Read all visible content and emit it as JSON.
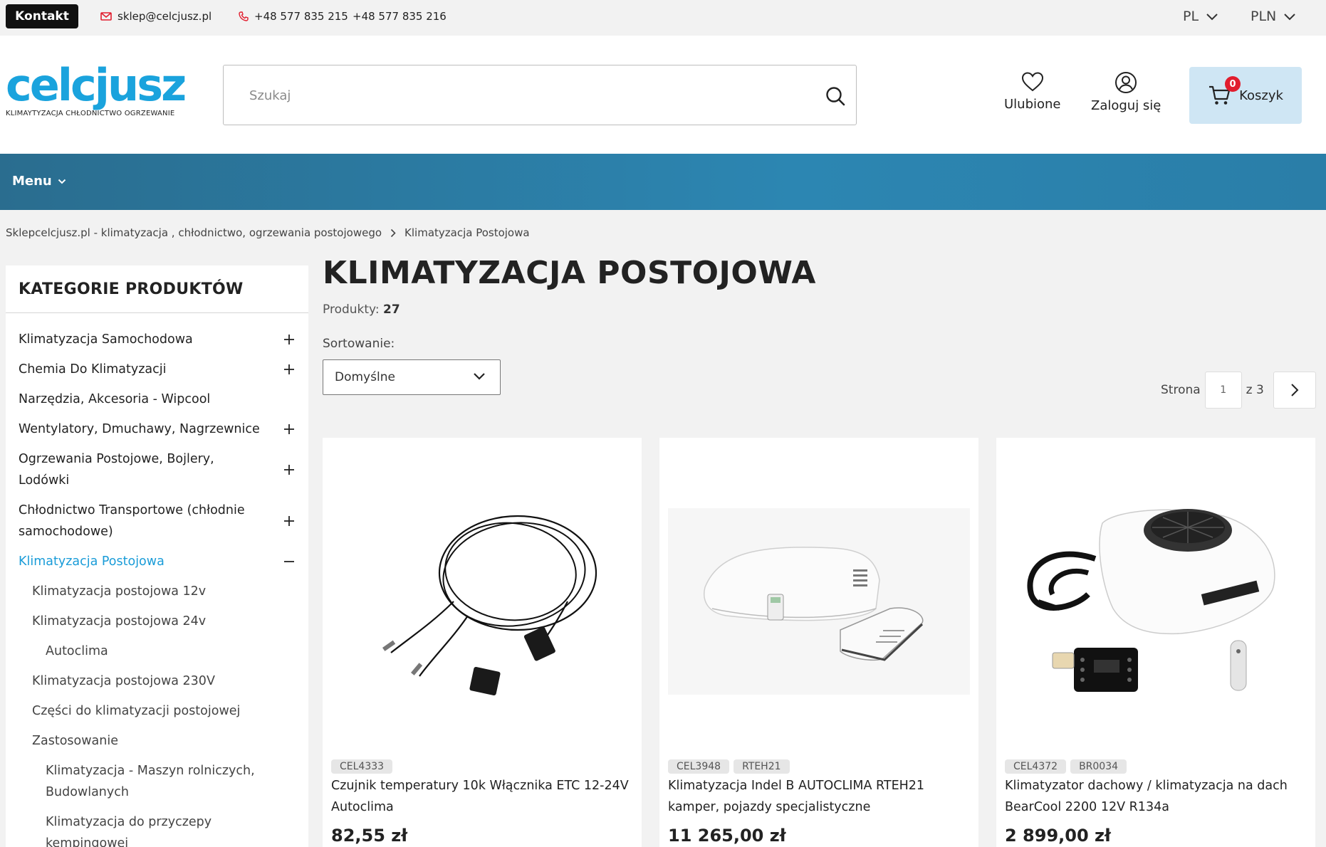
{
  "topbar": {
    "contact_label": "Kontakt",
    "email": "sklep@celcjusz.pl",
    "phone1": "+48 577 835 215",
    "phone2": "+48 577 835 216",
    "language": "PL",
    "currency": "PLN"
  },
  "header": {
    "logo_text": "celcjusz",
    "logo_tagline": "KLIMAYTYZACJA CHŁODNICTWO OGRZEWANIE",
    "search_placeholder": "Szukaj",
    "favorites_label": "Ulubione",
    "login_label": "Zaloguj się",
    "cart_label": "Koszyk",
    "cart_count": "0",
    "brand_color": "#1aa3dd"
  },
  "nav": {
    "menu_label": "Menu"
  },
  "breadcrumb": {
    "home": "Sklepcelcjusz.pl - klimatyzacja , chłodnictwo, ogrzewania postojowego",
    "current": "Klimatyzacja Postojowa"
  },
  "sidebar": {
    "title": "KATEGORIE PRODUKTÓW",
    "items": [
      {
        "label": "Klimatyzacja Samochodowa",
        "toggle": "plus",
        "level": 0
      },
      {
        "label": "Chemia Do Klimatyzacji",
        "toggle": "plus",
        "level": 0
      },
      {
        "label": "Narzędzia, Akcesoria - Wipcool",
        "toggle": "none",
        "level": 0
      },
      {
        "label": "Wentylatory, Dmuchawy, Nagrzewnice",
        "toggle": "plus",
        "level": 0
      },
      {
        "label": "Ogrzewania Postojowe, Bojlery, Lodówki",
        "toggle": "plus",
        "level": 0
      },
      {
        "label": "Chłodnictwo Transportowe (chłodnie samochodowe)",
        "toggle": "plus",
        "level": 0
      },
      {
        "label": "Klimatyzacja Postojowa",
        "toggle": "minus",
        "level": 0,
        "active": true
      },
      {
        "label": "Klimatyzacja postojowa 12v",
        "toggle": "none",
        "level": 1
      },
      {
        "label": "Klimatyzacja postojowa 24v",
        "toggle": "none",
        "level": 1
      },
      {
        "label": "Autoclima",
        "toggle": "none",
        "level": 2
      },
      {
        "label": "Klimatyzacja postojowa 230V",
        "toggle": "none",
        "level": 1
      },
      {
        "label": "Części do klimatyzacji postojowej",
        "toggle": "none",
        "level": 1
      },
      {
        "label": "Zastosowanie",
        "toggle": "none",
        "level": 1
      },
      {
        "label": "Klimatyzacja - Maszyn rolniczych, Budowlanych",
        "toggle": "none",
        "level": 2
      },
      {
        "label": "Klimatyzacja do przyczepy kempingowej",
        "toggle": "none",
        "level": 2
      }
    ]
  },
  "main": {
    "title": "KLIMATYZACJA POSTOJOWA",
    "products_label": "Produkty:",
    "products_count": "27",
    "sort_label": "Sortowanie:",
    "sort_value": "Domyślne",
    "page_label": "Strona",
    "page_current": "1",
    "page_total": "z 3"
  },
  "products": [
    {
      "tags": [
        "CEL4333"
      ],
      "name": "Czujnik temperatury 10k Włącznika ETC 12-24V Autoclima",
      "price": "82,55 zł"
    },
    {
      "tags": [
        "CEL3948",
        "RTEH21"
      ],
      "name": "Klimatyzacja Indel B AUTOCLIMA RTEH21 kamper, pojazdy specjalistyczne",
      "price": "11 265,00 zł"
    },
    {
      "tags": [
        "CEL4372",
        "BR0034"
      ],
      "name": "Klimatyzator dachowy / klimatyzacja na dach BearCool 2200 12V R134a",
      "price": "2 899,00 zł"
    }
  ]
}
